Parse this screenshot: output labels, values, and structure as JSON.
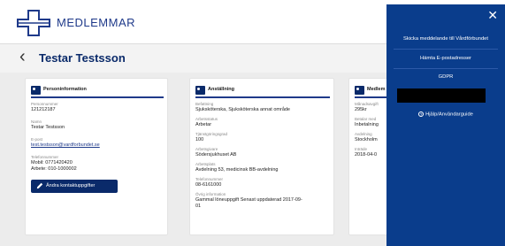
{
  "header": {
    "brand": "MEDLEMMAR"
  },
  "page": {
    "back_icon": "chevron-left-icon",
    "title": "Testar Testsson"
  },
  "personinfo": {
    "heading": "Personinformation",
    "fields": [
      {
        "label": "Personnummer",
        "value": "121212187"
      },
      {
        "label": "Namn",
        "value": "Testar Testsson"
      },
      {
        "label": "E-post",
        "value": "test.testsson@vardforbundet.se"
      },
      {
        "label": "Telefonnummer",
        "value": "Mobil: 0771420420",
        "value2": "Arbete: 010-1000002"
      }
    ],
    "edit_button": "Ändra kontaktuppgifter"
  },
  "employment": {
    "heading": "Anställning",
    "fields": [
      {
        "label": "Befattning",
        "value": "Sjuksköterska, Sjuksköterska annat område"
      },
      {
        "label": "Arbetsstatus",
        "value": "Arbetar"
      },
      {
        "label": "Tjänstgöringsgrad",
        "value": "100"
      },
      {
        "label": "Arbetsgivare",
        "value": "Södersjukhuset AB"
      },
      {
        "label": "Arbetsplats",
        "value": "Avdelning 53, medicinsk BB-avdelning"
      },
      {
        "label": "Telefonnummer",
        "value": "08-6161000"
      },
      {
        "label": "Övrig information",
        "value": "Gammal löneuppgift Senast uppdaterad 2017-09-",
        "value2": "01"
      }
    ]
  },
  "membership": {
    "heading": "Medlem",
    "fields": [
      {
        "label": "Månadsavgift",
        "value": "295kr"
      },
      {
        "label": "Betalar med",
        "value": "Inbetalning"
      },
      {
        "label": "Avdelning",
        "value": "Stockholm"
      },
      {
        "label": "Inträde",
        "value": "2018-04-0"
      }
    ]
  },
  "panel": {
    "close_icon": "close-icon",
    "items": [
      "Skicka meddelande till Vårdförbundet",
      "Hämta E-postadresser",
      "GDPR"
    ],
    "help": "Hjälp/Användarguide"
  },
  "colors": {
    "primary": "#0a2a6a",
    "panel": "#0a3d8c",
    "background": "#ececec"
  }
}
